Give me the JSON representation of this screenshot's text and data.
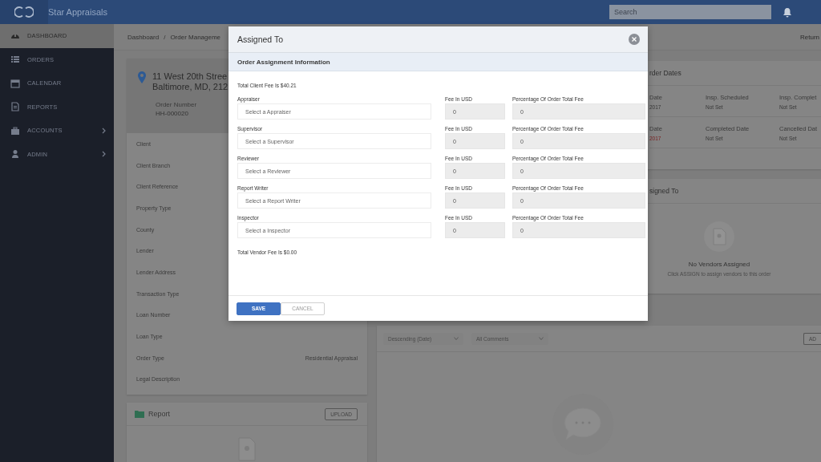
{
  "app": {
    "title": "Star Appraisals"
  },
  "topbar": {
    "search": {
      "placeholder": "Search"
    }
  },
  "sidebar": {
    "items": [
      {
        "label": "DASHBOARD",
        "selected": true,
        "has_submenu": false
      },
      {
        "label": "ORDERS",
        "selected": false,
        "has_submenu": false
      },
      {
        "label": "CALENDAR",
        "selected": false,
        "has_submenu": false
      },
      {
        "label": "REPORTS",
        "selected": false,
        "has_submenu": false
      },
      {
        "label": "ACCOUNTS",
        "selected": false,
        "has_submenu": true
      },
      {
        "label": "ADMIN",
        "selected": false,
        "has_submenu": true
      }
    ]
  },
  "breadcrumb": {
    "items": [
      "Dashboard",
      "Order Manageme"
    ],
    "separator": "/",
    "return_link": "Return"
  },
  "order": {
    "address_line1": "11 West 20th Stree",
    "address_line2": "Baltimore, MD, 212",
    "number_label": "Order Number",
    "number": "HH-000020",
    "details": [
      {
        "label": "Client"
      },
      {
        "label": "Client Branch"
      },
      {
        "label": "Client Reference"
      },
      {
        "label": "Property Type"
      },
      {
        "label": "County"
      },
      {
        "label": "Lender"
      },
      {
        "label": "Lender Address"
      },
      {
        "label": "Transaction Type"
      },
      {
        "label": "Loan Number"
      },
      {
        "label": "Loan Type"
      },
      {
        "label": "Order Type",
        "value": "Residential Appraisal"
      },
      {
        "label": "Legal Description"
      }
    ]
  },
  "report": {
    "title": "Report",
    "button": "UPLOAD"
  },
  "order_dates": {
    "title": "rder Dates",
    "items": [
      {
        "label": "Date",
        "value": "2017",
        "overdue": false
      },
      {
        "label": "Insp. Scheduled",
        "value": "Not Set",
        "overdue": false
      },
      {
        "label": "Insp. Complet",
        "value": "Not Set",
        "overdue": false
      },
      {
        "label": "Date",
        "value": "2017",
        "overdue": true
      },
      {
        "label": "Completed Date",
        "value": "Not Set",
        "overdue": false
      },
      {
        "label": "Cancelled Dat",
        "value": "Not Set",
        "overdue": false
      }
    ]
  },
  "vendors": {
    "title": "signed To",
    "empty_title": "No Vendors Assigned",
    "empty_hint": "Click ASSIGN to assign vendors to this order"
  },
  "comments": {
    "sort": "Descending (Date)",
    "filter": "All Comments",
    "add_button": "AD"
  },
  "modal": {
    "title": "Assigned To",
    "section": "Order Assignment Information",
    "client_fee": "Total Client Fee Is $40.21",
    "roles": [
      {
        "label": "Appraiser",
        "placeholder": "Select a Appraiser",
        "fee_label": "Fee In USD",
        "fee": "0",
        "pct_label": "Percentage Of Order Total Fee",
        "pct": "0"
      },
      {
        "label": "Supervisor",
        "placeholder": "Select a Supervisor",
        "fee_label": "Fee In USD",
        "fee": "0",
        "pct_label": "Percentage Of Order Total Fee",
        "pct": "0"
      },
      {
        "label": "Reviewer",
        "placeholder": "Select a Reviewer",
        "fee_label": "Fee In USD",
        "fee": "0",
        "pct_label": "Percentage Of Order Total Fee",
        "pct": "0"
      },
      {
        "label": "Report Writer",
        "placeholder": "Select a Report Writer",
        "fee_label": "Fee In USD",
        "fee": "0",
        "pct_label": "Percentage Of Order Total Fee",
        "pct": "0"
      },
      {
        "label": "Inspector",
        "placeholder": "Select a Inspector",
        "fee_label": "Fee In USD",
        "fee": "0",
        "pct_label": "Percentage Of Order Total Fee",
        "pct": "0"
      }
    ],
    "vendor_fee": "Total Vendor Fee Is $0.00",
    "buttons": [
      {
        "label": "SAVE",
        "kind": "primary"
      },
      {
        "label": "CANCEL",
        "kind": "secondary"
      }
    ]
  }
}
